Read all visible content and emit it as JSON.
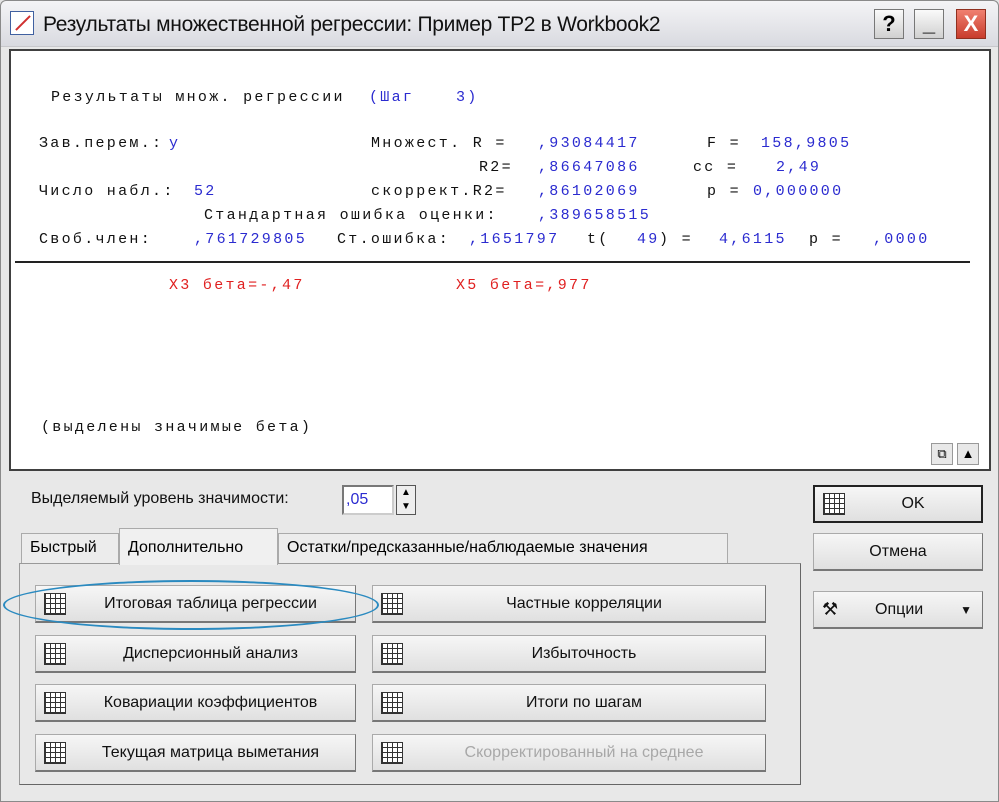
{
  "window": {
    "title": "Результаты множественной регрессии: Пример TP2 в Workbook2",
    "help": "?",
    "minimize": "_",
    "close": "X"
  },
  "output": {
    "header": "Результаты множ. регрессии",
    "step_label": "(Шаг",
    "step_value": "3)",
    "dep_label": "Зав.перем.:",
    "dep_value": "y",
    "r_label": "Множест. R =",
    "r_value": ",93084417",
    "f_label": "F =",
    "f_value": "158,9805",
    "r2_label": "R2=",
    "r2_value": ",86647086",
    "cc_label": "cc =",
    "cc_value": "2,49",
    "n_label": "Число набл.:",
    "n_value": "52",
    "adjr2_label": "скоррект.R2=",
    "adjr2_value": ",86102069",
    "p_label": "p =",
    "p_value": "0,000000",
    "se_label": "Стандартная ошибка оценки:",
    "se_value": ",389658515",
    "int_label": "Своб.член:",
    "int_value": ",761729805",
    "int_se_label": "Ст.ошибка:",
    "int_se_value": ",1651797",
    "t_label": "t(",
    "t_df": "49",
    "t_eq": ") =",
    "t_value": "4,6115",
    "int_p_label": "p =",
    "int_p_value": ",0000",
    "beta1": "X3 бета=-,47",
    "beta2": "X5 бета=,977",
    "note": "(выделены значимые бета)"
  },
  "significance": {
    "label": "Выделяемый уровень значимости:",
    "value": ",05"
  },
  "tabs": [
    {
      "label": "Быстрый"
    },
    {
      "label": "Дополнительно"
    },
    {
      "label": "Остатки/предсказанные/наблюдаемые значения"
    }
  ],
  "buttons": {
    "summary": "Итоговая таблица регрессии",
    "partial": "Частные корреляции",
    "anova": "Дисперсионный анализ",
    "redundancy": "Избыточность",
    "covariance": "Ковариации коэффициентов",
    "steps": "Итоги по шагам",
    "sweep": "Текущая матрица выметания",
    "centered": "Скорректированный на среднее"
  },
  "side": {
    "ok": "OK",
    "cancel": "Отмена",
    "options": "Опции"
  }
}
